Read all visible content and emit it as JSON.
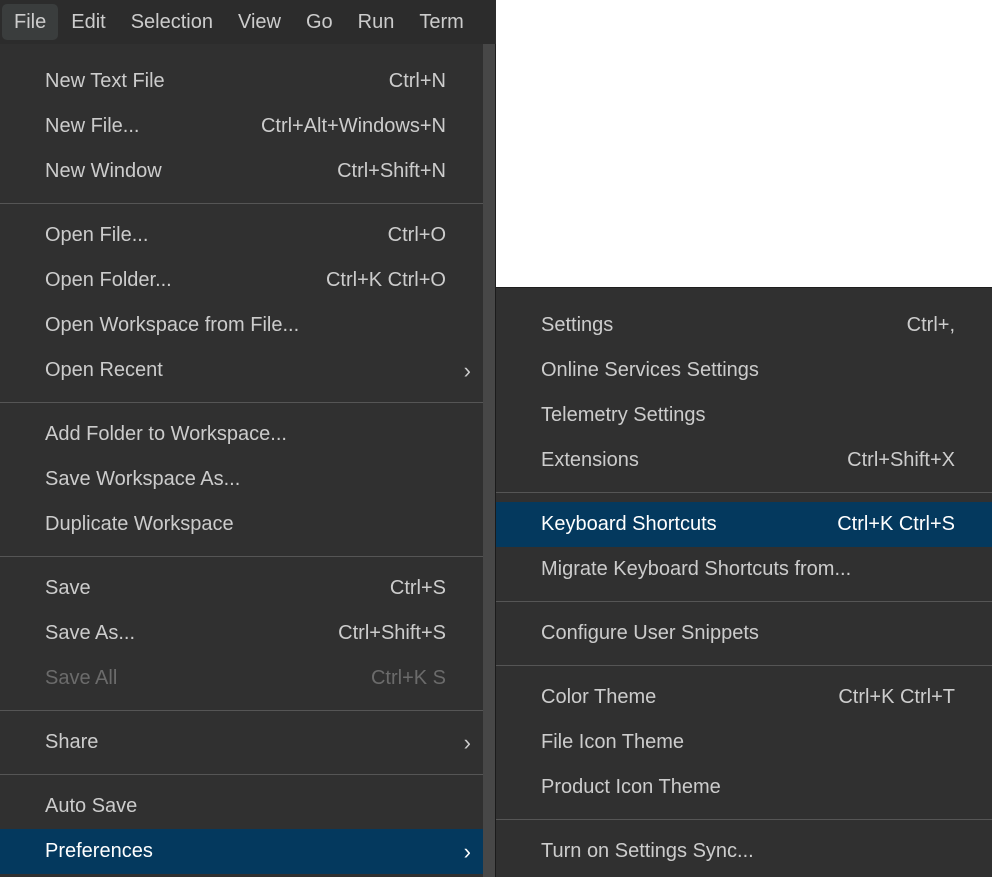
{
  "menubar": [
    "File",
    "Edit",
    "Selection",
    "View",
    "Go",
    "Run",
    "Term"
  ],
  "main_menu": [
    [
      {
        "label": "New Text File",
        "shortcut": "Ctrl+N"
      },
      {
        "label": "New File...",
        "shortcut": "Ctrl+Alt+Windows+N"
      },
      {
        "label": "New Window",
        "shortcut": "Ctrl+Shift+N"
      }
    ],
    [
      {
        "label": "Open File...",
        "shortcut": "Ctrl+O"
      },
      {
        "label": "Open Folder...",
        "shortcut": "Ctrl+K Ctrl+O"
      },
      {
        "label": "Open Workspace from File..."
      },
      {
        "label": "Open Recent",
        "submenu": true
      }
    ],
    [
      {
        "label": "Add Folder to Workspace..."
      },
      {
        "label": "Save Workspace As..."
      },
      {
        "label": "Duplicate Workspace"
      }
    ],
    [
      {
        "label": "Save",
        "shortcut": "Ctrl+S"
      },
      {
        "label": "Save As...",
        "shortcut": "Ctrl+Shift+S"
      },
      {
        "label": "Save All",
        "shortcut": "Ctrl+K S",
        "disabled": true
      }
    ],
    [
      {
        "label": "Share",
        "submenu": true
      }
    ],
    [
      {
        "label": "Auto Save"
      },
      {
        "label": "Preferences",
        "submenu": true,
        "highlighted": true
      }
    ]
  ],
  "sub_menu": [
    [
      {
        "label": "Settings",
        "shortcut": "Ctrl+,"
      },
      {
        "label": "Online Services Settings"
      },
      {
        "label": "Telemetry Settings"
      },
      {
        "label": "Extensions",
        "shortcut": "Ctrl+Shift+X"
      }
    ],
    [
      {
        "label": "Keyboard Shortcuts",
        "shortcut": "Ctrl+K Ctrl+S",
        "highlighted": true
      },
      {
        "label": "Migrate Keyboard Shortcuts from..."
      }
    ],
    [
      {
        "label": "Configure User Snippets"
      }
    ],
    [
      {
        "label": "Color Theme",
        "shortcut": "Ctrl+K Ctrl+T"
      },
      {
        "label": "File Icon Theme"
      },
      {
        "label": "Product Icon Theme"
      }
    ],
    [
      {
        "label": "Turn on Settings Sync..."
      }
    ]
  ],
  "chevron_icon": "chevron-right-icon",
  "colors": {
    "menu_bg": "#303030",
    "highlight": "#04395e",
    "text": "#cccccc",
    "disabled": "#6b6b6b"
  }
}
